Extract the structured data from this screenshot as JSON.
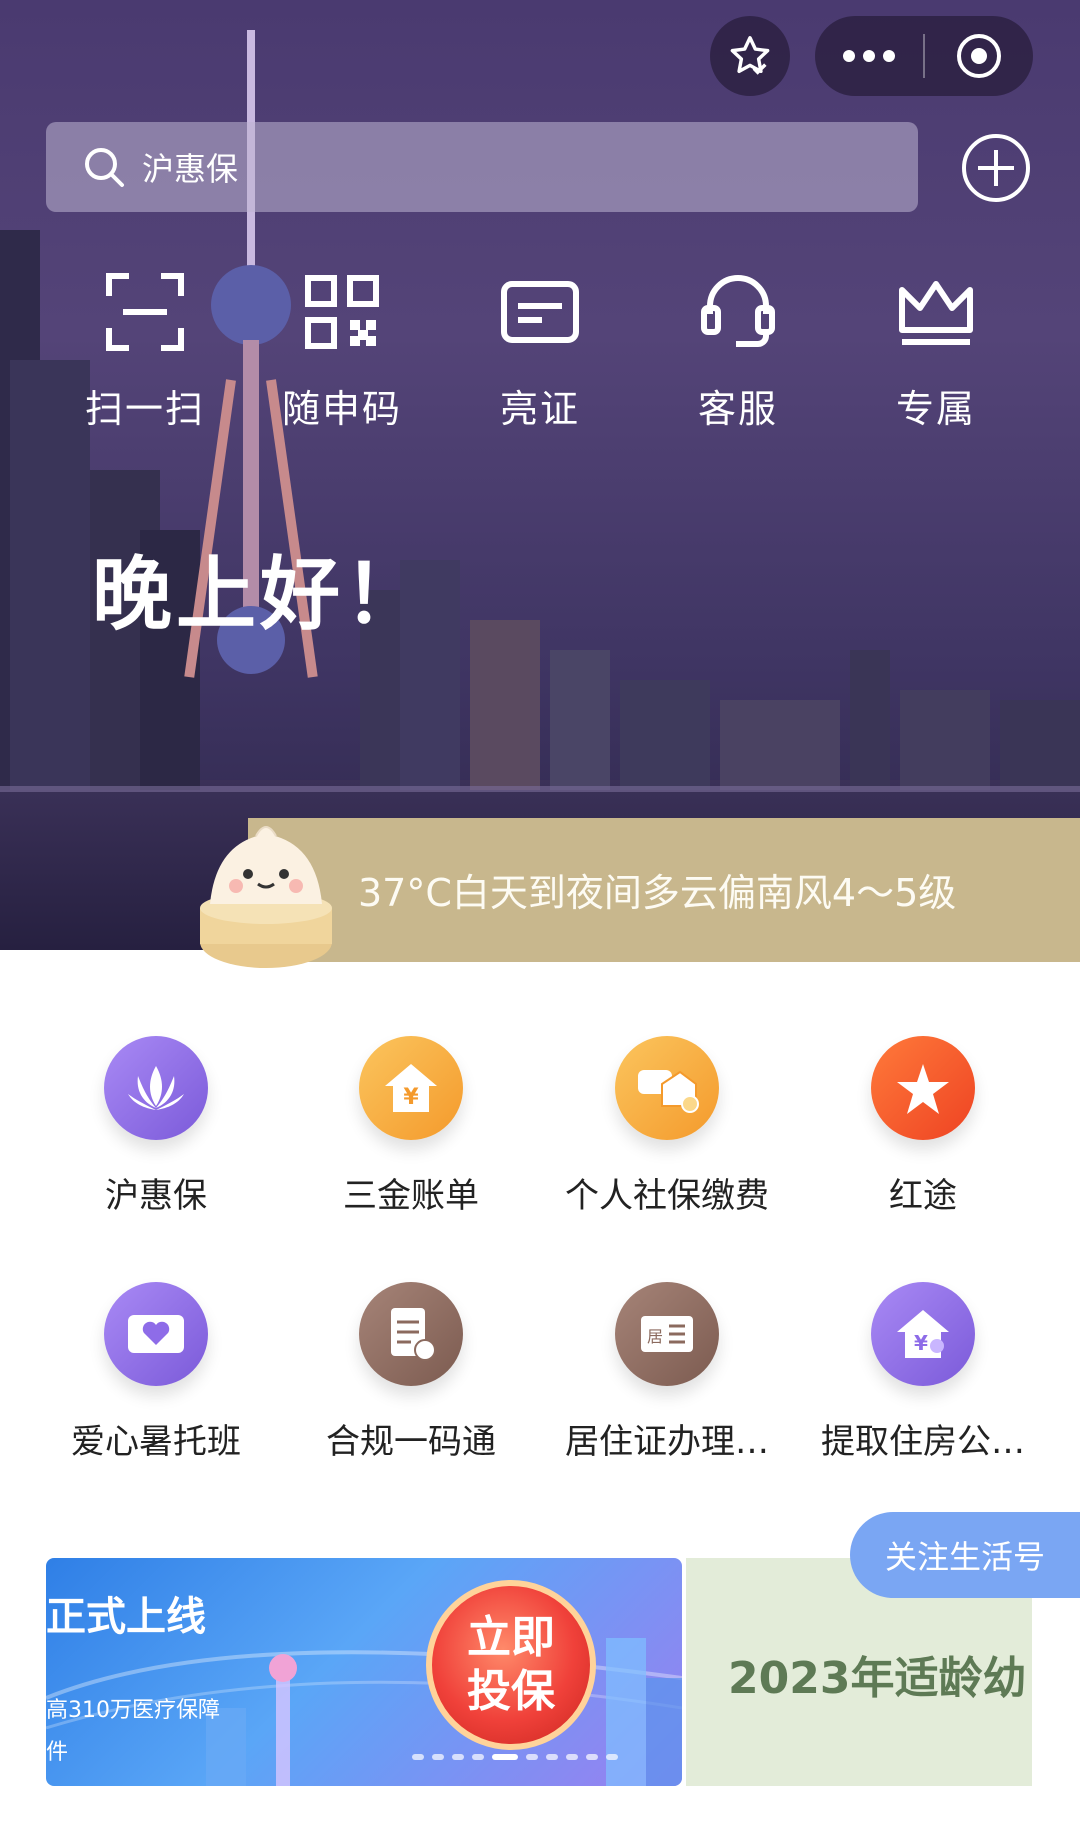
{
  "search": {
    "placeholder": "沪惠保"
  },
  "quick_actions": [
    {
      "label": "扫一扫",
      "icon": "scan-icon"
    },
    {
      "label": "随申码",
      "icon": "qr-code-icon"
    },
    {
      "label": "亮证",
      "icon": "id-card-icon"
    },
    {
      "label": "客服",
      "icon": "headset-icon"
    },
    {
      "label": "专属",
      "icon": "crown-icon"
    }
  ],
  "greeting": "晚上好！",
  "weather": "37°C白天到夜间多云偏南风4～5级",
  "services": [
    {
      "label": "沪惠保",
      "icon": "lotus-icon",
      "color": "#8e6ce8"
    },
    {
      "label": "三金账单",
      "icon": "house-yuan-icon",
      "color": "#f7a33a"
    },
    {
      "label": "个人社保缴费",
      "icon": "social-security-icon",
      "color": "#f6a43c"
    },
    {
      "label": "红途",
      "icon": "red-star-icon",
      "color": "#f2522b"
    },
    {
      "label": "爱心暑托班",
      "icon": "heart-card-icon",
      "color": "#8e6ce8"
    },
    {
      "label": "合规一码通",
      "icon": "document-icon",
      "color": "#8b6a5e"
    },
    {
      "label": "居住证办理…",
      "icon": "residence-card-icon",
      "color": "#8b6a5e"
    },
    {
      "label": "提取住房公…",
      "icon": "housing-fund-icon",
      "color": "#8e6ce8"
    }
  ],
  "banner": {
    "title": "正式上线",
    "subtitle": "高310万医疗保障",
    "subtitle2": "件",
    "cta_line1": "立即",
    "cta_line2": "投保"
  },
  "side_banner": {
    "text": "2023年适龄幼"
  },
  "follow_button": "关注生活号"
}
